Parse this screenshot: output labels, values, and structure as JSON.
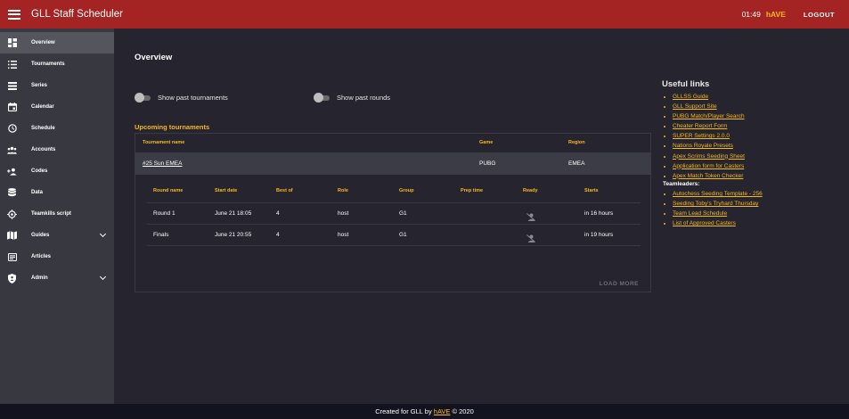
{
  "appbar": {
    "title": "GLL Staff Scheduler",
    "time": "01:49",
    "user": "hAVE",
    "logout": "LOGOUT"
  },
  "sidebar": {
    "items": [
      {
        "label": "Overview",
        "icon": "dashboard-icon"
      },
      {
        "label": "Tournaments",
        "icon": "list-icon"
      },
      {
        "label": "Series",
        "icon": "series-icon"
      },
      {
        "label": "Calendar",
        "icon": "calendar-icon"
      },
      {
        "label": "Schedule",
        "icon": "clock-icon"
      },
      {
        "label": "Accounts",
        "icon": "people-icon"
      },
      {
        "label": "Codes",
        "icon": "person-add-icon"
      },
      {
        "label": "Data",
        "icon": "database-icon"
      },
      {
        "label": "Teamkills script",
        "icon": "crosshair-icon"
      },
      {
        "label": "Guides",
        "icon": "map-icon"
      },
      {
        "label": "Articles",
        "icon": "article-icon"
      },
      {
        "label": "Admin",
        "icon": "shield-icon"
      }
    ]
  },
  "main": {
    "title": "Overview",
    "toggle_past_tournaments": "Show past tournaments",
    "toggle_past_rounds": "Show past rounds",
    "upcoming_title": "Upcoming tournaments",
    "table_headers": {
      "name": "Tournament name",
      "game": "Game",
      "region": "Region"
    },
    "tournament": {
      "name": "#25 Sun EMEA",
      "game": "PUBG",
      "region": "EMEA"
    },
    "round_headers": {
      "round": "Round name",
      "start": "Start date",
      "bestof": "Best of",
      "role": "Role",
      "group": "Group",
      "prep": "Prep time",
      "ready": "Ready",
      "starts": "Starts"
    },
    "rounds": [
      {
        "name": "Round 1",
        "start": "June 21 18:05",
        "bestof": "4",
        "role": "host",
        "group": "G1",
        "prep": "",
        "starts": "in 16 hours"
      },
      {
        "name": "Finals",
        "start": "June 21 20:55",
        "bestof": "4",
        "role": "host",
        "group": "G1",
        "prep": "",
        "starts": "in 19 hours"
      }
    ],
    "load_more": "LOAD MORE"
  },
  "useful_links": {
    "title": "Useful links",
    "links": [
      "GLLSS Guide",
      "GLL Support Site",
      "PUBG Match/Player Search",
      "Cheater Report Form",
      "SUPER Settings 2.0.0",
      "Nations Royale Presets",
      "Apex Scrims Seeding Sheet",
      "Application form for Casters",
      "Apex Match Token Checker"
    ],
    "teamleaders_title": "Teamleaders:",
    "teamleader_links": [
      "Autochess Seeding Template - 256",
      "Seeding Toby's Tryhard Thursday",
      "Team Lead Schedule",
      "List of Approved Casters"
    ]
  },
  "footer": {
    "prefix": "Created for GLL by",
    "author": "hAVE",
    "suffix": "© 2020"
  },
  "colors": {
    "appbar": "#a32422",
    "accent": "#f5b921",
    "background": "#25242f",
    "sidebar": "#383841",
    "footer": "#131320"
  }
}
